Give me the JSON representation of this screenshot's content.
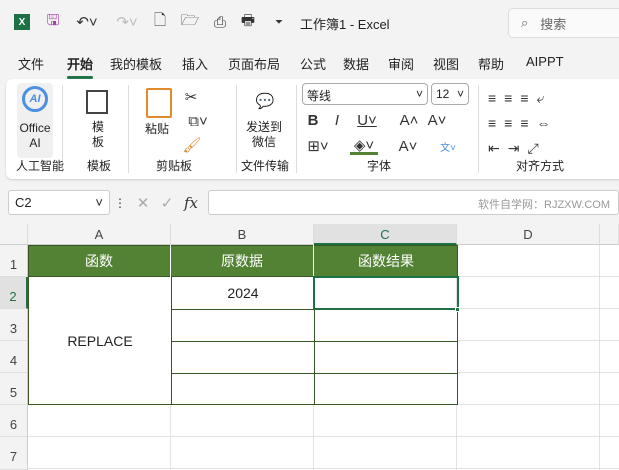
{
  "titlebar": {
    "title": "工作簿1  -  Excel",
    "search_placeholder": "搜索"
  },
  "tabs": [
    {
      "label": "文件"
    },
    {
      "label": "开始",
      "active": true
    },
    {
      "label": "我的模板"
    },
    {
      "label": "插入"
    },
    {
      "label": "页面布局"
    },
    {
      "label": "公式"
    },
    {
      "label": "数据"
    },
    {
      "label": "审阅"
    },
    {
      "label": "视图"
    },
    {
      "label": "帮助"
    },
    {
      "label": "AIPPT"
    }
  ],
  "ribbon": {
    "office_ai": "Office AI",
    "template": "模板",
    "paste": "粘贴",
    "send_wechat": "发送到微信",
    "font_name": "等线",
    "font_size": "12",
    "groups": {
      "ai": "人工智能",
      "template": "模板",
      "clipboard": "剪贴板",
      "file_transfer": "文件传输",
      "font": "字体",
      "alignment": "对齐方式"
    }
  },
  "formula_bar": {
    "name_box": "C2",
    "fx": "fx",
    "watermark": "软件自学网：RJZXW.COM"
  },
  "columns": [
    "A",
    "B",
    "C",
    "D"
  ],
  "rows": [
    "1",
    "2",
    "3",
    "4",
    "5",
    "6",
    "7"
  ],
  "table": {
    "headers": [
      "函数",
      "原数据",
      "函数结果"
    ],
    "function_name": "REPLACE",
    "data_value": "2024"
  },
  "colors": {
    "header_fill": "#548235",
    "accent": "#1e7145"
  }
}
